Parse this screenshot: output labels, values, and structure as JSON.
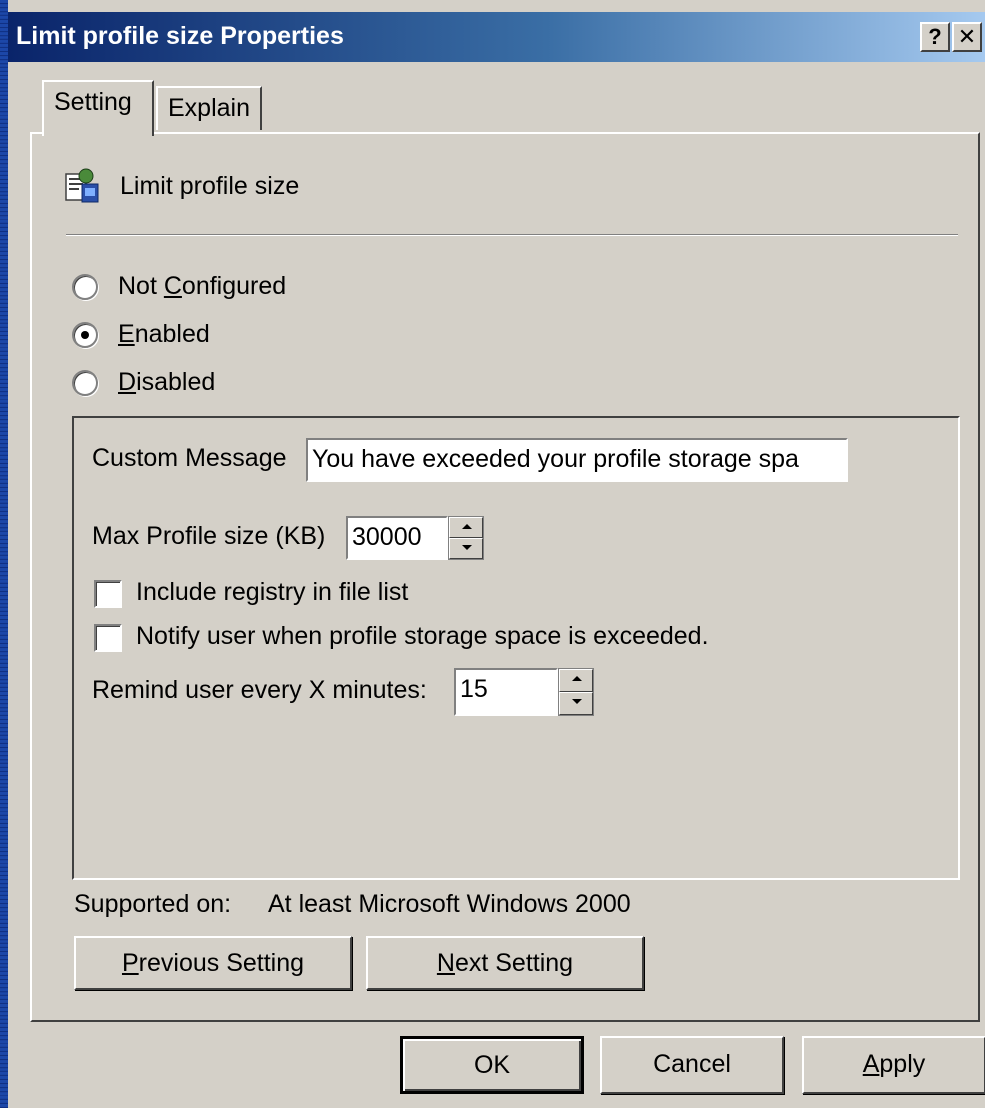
{
  "window": {
    "title": "Limit profile size Properties"
  },
  "titlebar_buttons": {
    "help": "?",
    "close": "✕"
  },
  "tabs": [
    {
      "label": "Setting",
      "selected": true
    },
    {
      "label": "Explain",
      "selected": false
    }
  ],
  "policy": {
    "name": "Limit profile size",
    "icon": "group-policy-icon"
  },
  "state": {
    "selected": "Enabled",
    "options": [
      {
        "label_before": "Not ",
        "accel": "C",
        "label_after": "onfigured"
      },
      {
        "label_before": "",
        "accel": "E",
        "label_after": "nabled"
      },
      {
        "label_before": "",
        "accel": "D",
        "label_after": "isabled"
      }
    ]
  },
  "options": {
    "custom_message": {
      "label": "Custom Message",
      "value": "You have exceeded your profile storage spa"
    },
    "max_profile_size": {
      "label": "Max Profile size (KB)",
      "value": "30000"
    },
    "include_registry": {
      "label": "Include registry in file list",
      "checked": false
    },
    "notify_user": {
      "label": "Notify user when profile storage space is exceeded.",
      "checked": false
    },
    "remind_user": {
      "label": "Remind user every X minutes:",
      "value": "15"
    }
  },
  "supported": {
    "label": "Supported on:",
    "value": "At least Microsoft Windows 2000"
  },
  "nav_buttons": {
    "previous": {
      "accel": "P",
      "rest": "revious Setting"
    },
    "next": {
      "accel": "N",
      "rest": "ext Setting"
    }
  },
  "footer_buttons": {
    "ok": "OK",
    "cancel": "Cancel",
    "apply": {
      "accel": "A",
      "rest": "pply"
    }
  },
  "colors": {
    "title_bar_start": "#0a246a",
    "title_bar_end": "#a6caf0",
    "face": "#d4d0c8",
    "desktop": "#1c47a8"
  }
}
